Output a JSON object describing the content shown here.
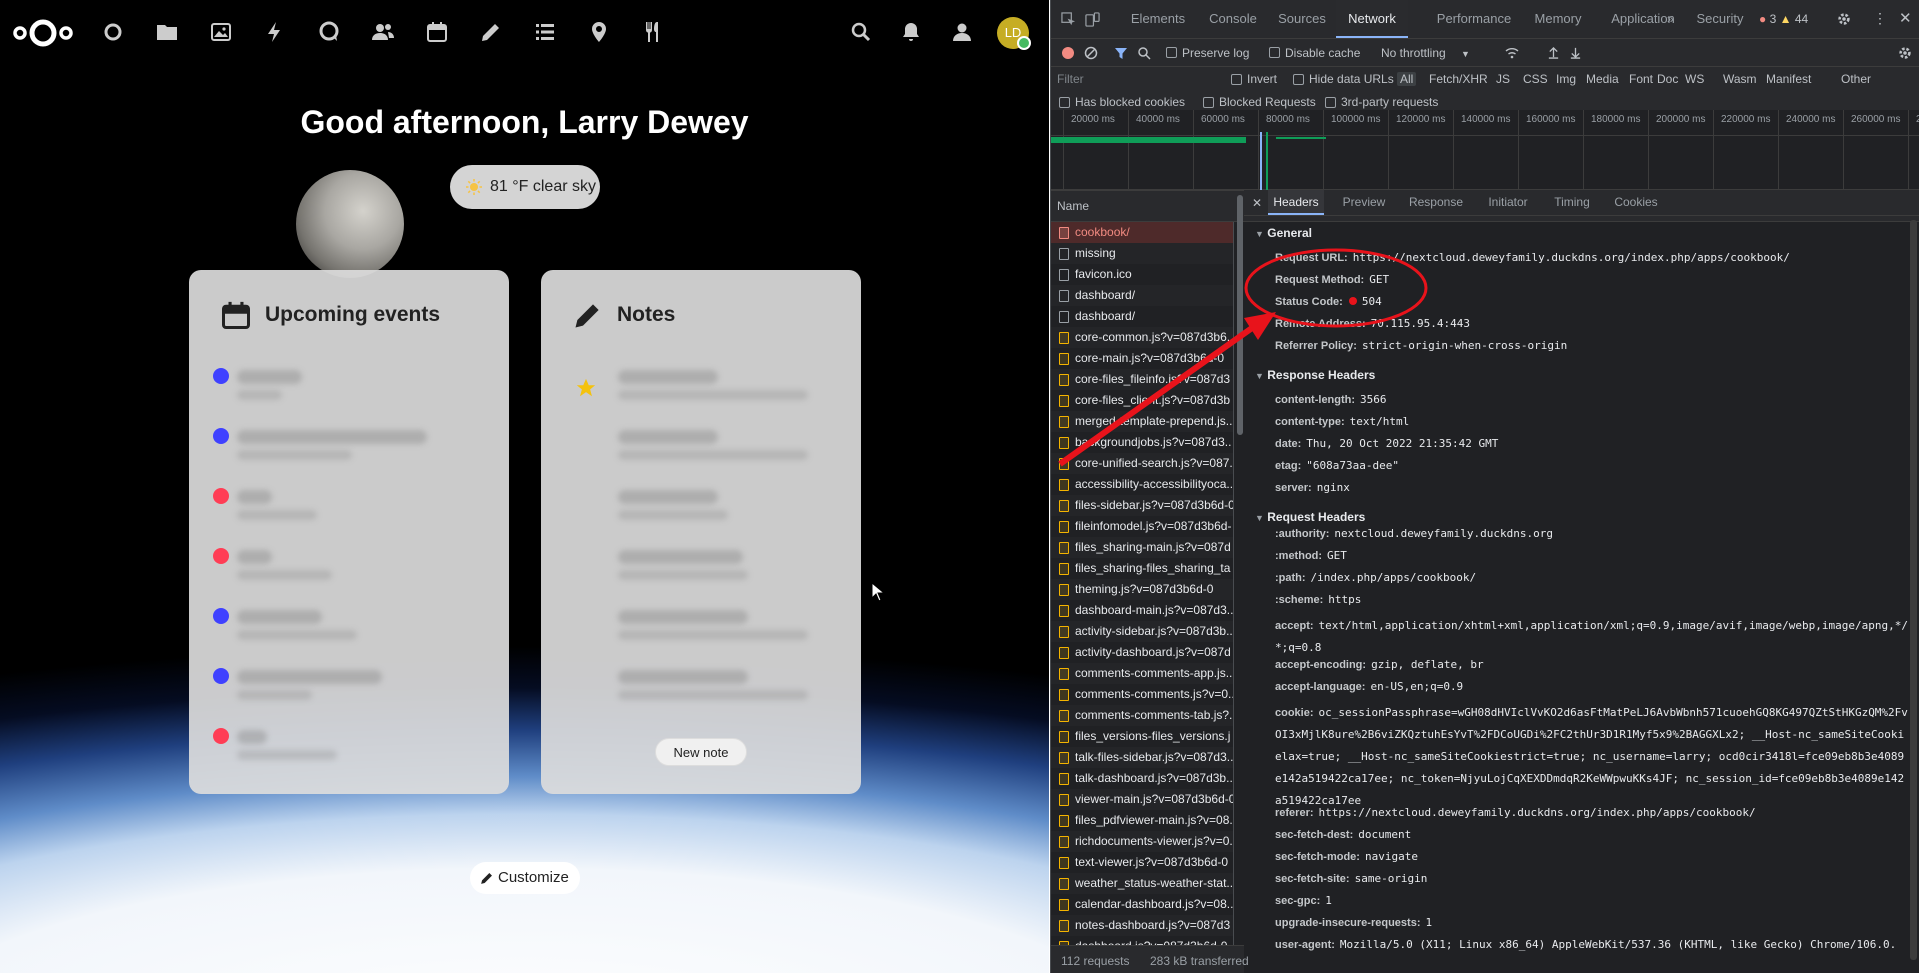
{
  "nextcloud": {
    "greeting": "Good afternoon, Larry Dewey",
    "weather": "81 °F clear sky",
    "avatar_initials": "LD",
    "events_title": "Upcoming events",
    "notes_title": "Notes",
    "new_note": "New note",
    "customize": "Customize",
    "apps": [
      "dashboard-icon",
      "files-icon",
      "photos-icon",
      "activity-icon",
      "talk-icon",
      "contacts-icon",
      "calendar-icon",
      "notes-icon",
      "tasks-icon",
      "maps-icon",
      "cookbook-icon"
    ],
    "event_dot_colors": [
      "#3f41ff",
      "#3f41ff",
      "#ff3d55",
      "#ff3d55",
      "#3f41ff",
      "#3f41ff",
      "#ff3d55"
    ]
  },
  "devtools": {
    "tabs": [
      "Elements",
      "Console",
      "Sources",
      "Network",
      "Performance",
      "Memory",
      "Application",
      "Security"
    ],
    "active_tab": "Network",
    "errors": "3",
    "warnings": "44",
    "preserve_log": "Preserve log",
    "disable_cache": "Disable cache",
    "throttling": "No throttling",
    "filter_placeholder": "Filter",
    "invert": "Invert",
    "hide_data_urls": "Hide data URLs",
    "type_filters": [
      "All",
      "Fetch/XHR",
      "JS",
      "CSS",
      "Img",
      "Media",
      "Font",
      "Doc",
      "WS",
      "Wasm",
      "Manifest",
      "Other"
    ],
    "has_blocked_cookies": "Has blocked cookies",
    "blocked_requests": "Blocked Requests",
    "third_party": "3rd-party requests",
    "timeline_ticks": [
      "20000 ms",
      "40000 ms",
      "60000 ms",
      "80000 ms",
      "100000 ms",
      "120000 ms",
      "140000 ms",
      "160000 ms",
      "180000 ms",
      "200000 ms",
      "220000 ms",
      "240000 ms",
      "260000 ms",
      "2"
    ],
    "name_header": "Name",
    "requests": [
      {
        "name": "cookbook/",
        "type": "err"
      },
      {
        "name": "missing",
        "type": "doc"
      },
      {
        "name": "favicon.ico",
        "type": "doc"
      },
      {
        "name": "dashboard/",
        "type": "doc"
      },
      {
        "name": "dashboard/",
        "type": "doc"
      },
      {
        "name": "core-common.js?v=087d3b6.",
        "type": "js"
      },
      {
        "name": "core-main.js?v=087d3b6d-0",
        "type": "js"
      },
      {
        "name": "core-files_fileinfo.js?v=087d3",
        "type": "js"
      },
      {
        "name": "core-files_client.js?v=087d3b",
        "type": "js"
      },
      {
        "name": "merged-template-prepend.js..",
        "type": "js"
      },
      {
        "name": "backgroundjobs.js?v=087d3..",
        "type": "js"
      },
      {
        "name": "core-unified-search.js?v=087..",
        "type": "js"
      },
      {
        "name": "accessibility-accessibilityoca..",
        "type": "js"
      },
      {
        "name": "files-sidebar.js?v=087d3b6d-0",
        "type": "js"
      },
      {
        "name": "fileinfomodel.js?v=087d3b6d-",
        "type": "js"
      },
      {
        "name": "files_sharing-main.js?v=087d",
        "type": "js"
      },
      {
        "name": "files_sharing-files_sharing_ta",
        "type": "js"
      },
      {
        "name": "theming.js?v=087d3b6d-0",
        "type": "js"
      },
      {
        "name": "dashboard-main.js?v=087d3..",
        "type": "js"
      },
      {
        "name": "activity-sidebar.js?v=087d3b..",
        "type": "js"
      },
      {
        "name": "activity-dashboard.js?v=087d",
        "type": "js"
      },
      {
        "name": "comments-comments-app.js..",
        "type": "js"
      },
      {
        "name": "comments-comments.js?v=0..",
        "type": "js"
      },
      {
        "name": "comments-comments-tab.js?..",
        "type": "js"
      },
      {
        "name": "files_versions-files_versions.j",
        "type": "js"
      },
      {
        "name": "talk-files-sidebar.js?v=087d3..",
        "type": "js"
      },
      {
        "name": "talk-dashboard.js?v=087d3b..",
        "type": "js"
      },
      {
        "name": "viewer-main.js?v=087d3b6d-0",
        "type": "js"
      },
      {
        "name": "files_pdfviewer-main.js?v=08..",
        "type": "js"
      },
      {
        "name": "richdocuments-viewer.js?v=0..",
        "type": "js"
      },
      {
        "name": "text-viewer.js?v=087d3b6d-0",
        "type": "js"
      },
      {
        "name": "weather_status-weather-stat..",
        "type": "js"
      },
      {
        "name": "calendar-dashboard.js?v=08..",
        "type": "js"
      },
      {
        "name": "notes-dashboard.js?v=087d3",
        "type": "js"
      },
      {
        "name": "dashboard.js?v=087d3b6d-0",
        "type": "js"
      }
    ],
    "request_count": "112 requests",
    "transferred": "283 kB transferred",
    "detail_tabs": [
      "Headers",
      "Preview",
      "Response",
      "Initiator",
      "Timing",
      "Cookies"
    ],
    "general_title": "General",
    "general": [
      {
        "k": "Request URL:",
        "v": "https://nextcloud.deweyfamily.duckdns.org/index.php/apps/cookbook/"
      },
      {
        "k": "Request Method:",
        "v": "GET"
      },
      {
        "k": "Status Code:",
        "v": "504"
      },
      {
        "k": "Remote Address:",
        "v": "70.115.95.4:443"
      },
      {
        "k": "Referrer Policy:",
        "v": "strict-origin-when-cross-origin"
      }
    ],
    "response_title": "Response Headers",
    "response": [
      {
        "k": "content-length:",
        "v": "3566"
      },
      {
        "k": "content-type:",
        "v": "text/html"
      },
      {
        "k": "date:",
        "v": "Thu, 20 Oct 2022 21:35:42 GMT"
      },
      {
        "k": "etag:",
        "v": "\"608a73aa-dee\""
      },
      {
        "k": "server:",
        "v": "nginx"
      }
    ],
    "request_title": "Request Headers",
    "request": [
      {
        "k": ":authority:",
        "v": "nextcloud.deweyfamily.duckdns.org"
      },
      {
        "k": ":method:",
        "v": "GET"
      },
      {
        "k": ":path:",
        "v": "/index.php/apps/cookbook/"
      },
      {
        "k": ":scheme:",
        "v": "https"
      },
      {
        "k": "accept:",
        "v": "text/html,application/xhtml+xml,application/xml;q=0.9,image/avif,image/webp,image/apng,*/*;q=0.8"
      },
      {
        "k": "accept-encoding:",
        "v": "gzip, deflate, br"
      },
      {
        "k": "accept-language:",
        "v": "en-US,en;q=0.9"
      },
      {
        "k": "cookie:",
        "v": "oc_sessionPassphrase=wGH08dHVIclVvKO2d6asFtMatPeLJ6AvbWbnh571cuoehGQ8KG497QZtStHKGzQM%2FvOI3xMjlK8ure%2B6viZKQztuhEsYvT%2FDCoUGDi%2FC2thUr3D1R1Myf5x9%2BAGGXLx2; __Host-nc_sameSiteCookielax=true; __Host-nc_sameSiteCookiestrict=true; nc_username=larry; ocd0cir3418l=fce09eb8b3e4089e142a519422ca17ee; nc_token=NjyuLojCqXEXDDmdqR2KeWWpwuKKs4JF; nc_session_id=fce09eb8b3e4089e142a519422ca17ee"
      },
      {
        "k": "referer:",
        "v": "https://nextcloud.deweyfamily.duckdns.org/index.php/apps/cookbook/"
      },
      {
        "k": "sec-fetch-dest:",
        "v": "document"
      },
      {
        "k": "sec-fetch-mode:",
        "v": "navigate"
      },
      {
        "k": "sec-fetch-site:",
        "v": "same-origin"
      },
      {
        "k": "sec-gpc:",
        "v": "1"
      },
      {
        "k": "upgrade-insecure-requests:",
        "v": "1"
      },
      {
        "k": "user-agent:",
        "v": "Mozilla/5.0 (X11; Linux x86_64) AppleWebKit/537.36 (KHTML, like Gecko) Chrome/106.0."
      }
    ],
    "annotation_color": "#e8131b",
    "status_dot_color": "#e8131b"
  }
}
